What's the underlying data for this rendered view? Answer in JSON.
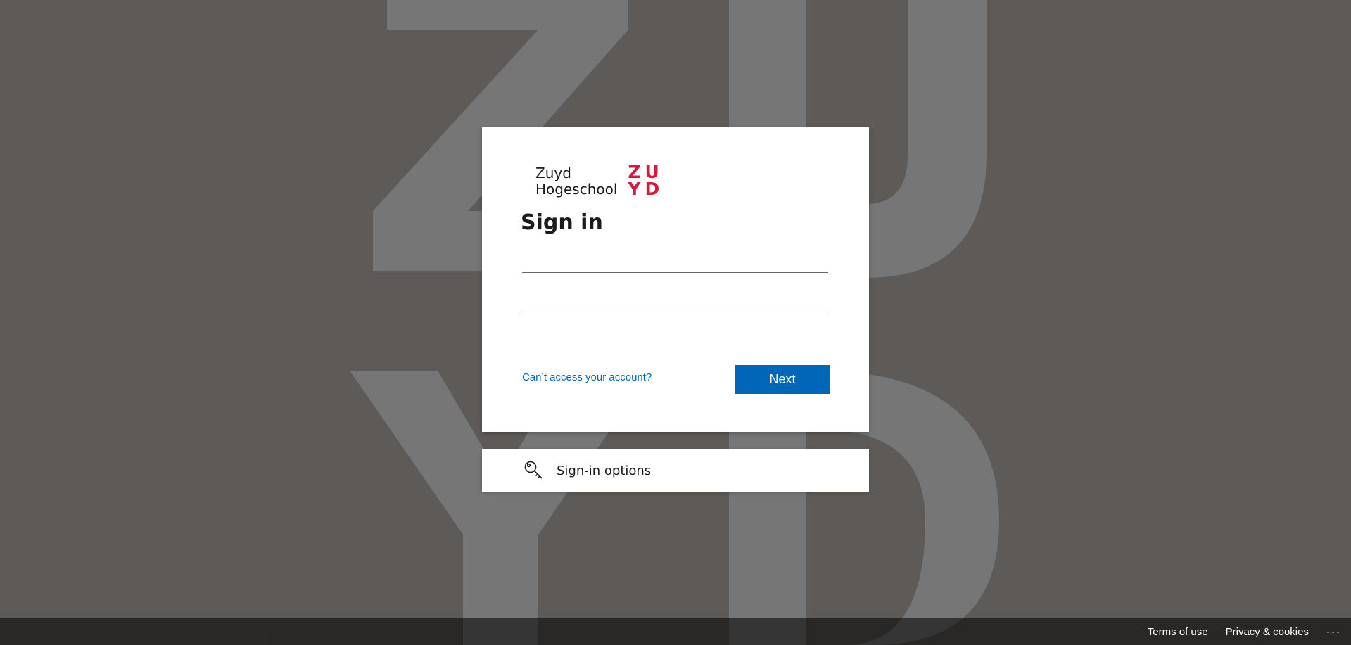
{
  "brand": {
    "name_line1": "Zuyd",
    "name_line2": "Hogeschool",
    "mark_line1": "ZU",
    "mark_line2": "YD",
    "mark_color": "#d7193f",
    "background_letters": "ZUYD"
  },
  "signin": {
    "title": "Sign in",
    "username_value": "",
    "password_value": "",
    "help_link": "Can’t access your account?",
    "next_label": "Next",
    "accent": "#0067b8"
  },
  "options": {
    "icon": "key-icon",
    "label": "Sign-in options"
  },
  "footer": {
    "terms": "Terms of use",
    "privacy": "Privacy & cookies",
    "more": "..."
  }
}
